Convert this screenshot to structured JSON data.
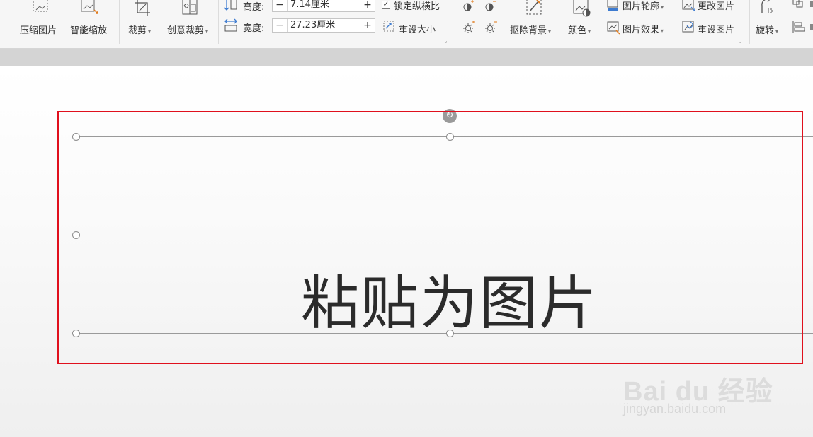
{
  "ribbon": {
    "compress_label": "压缩图片",
    "smart_zoom_label": "智能缩放",
    "crop_label": "裁剪",
    "creative_crop_label": "创意裁剪",
    "height_label": "高度:",
    "height_value": "7.14厘米",
    "width_label": "宽度:",
    "width_value": "27.23厘米",
    "lock_ratio_label": "锁定纵横比",
    "reset_size_label": "重设大小",
    "remove_bg_label": "抠除背景",
    "color_label": "颜色",
    "outline_label": "图片轮廓",
    "effect_label": "图片效果",
    "change_pic_label": "更改图片",
    "reset_pic_label": "重设图片",
    "rotate_label": "旋转",
    "minus": "−",
    "plus": "+"
  },
  "canvas": {
    "text": "粘贴为图片"
  },
  "watermark": {
    "logo": "Bai du 经验",
    "url": "jingyan.baidu.com"
  },
  "colors": {
    "highlight_frame": "#e0101d",
    "ribbon_bg": "#f6f6f6"
  },
  "icons": [
    "compress-icon",
    "smart-zoom-icon",
    "crop-icon",
    "creative-crop-icon",
    "height-icon",
    "width-icon",
    "reset-size-icon",
    "brightness-up-icon",
    "brightness-down-icon",
    "contrast-up-icon",
    "contrast-down-icon",
    "remove-bg-icon",
    "color-icon",
    "outline-icon",
    "effect-icon",
    "change-pic-icon",
    "reset-pic-icon",
    "rotate-icon",
    "align-icon",
    "rotation-handle-icon"
  ]
}
